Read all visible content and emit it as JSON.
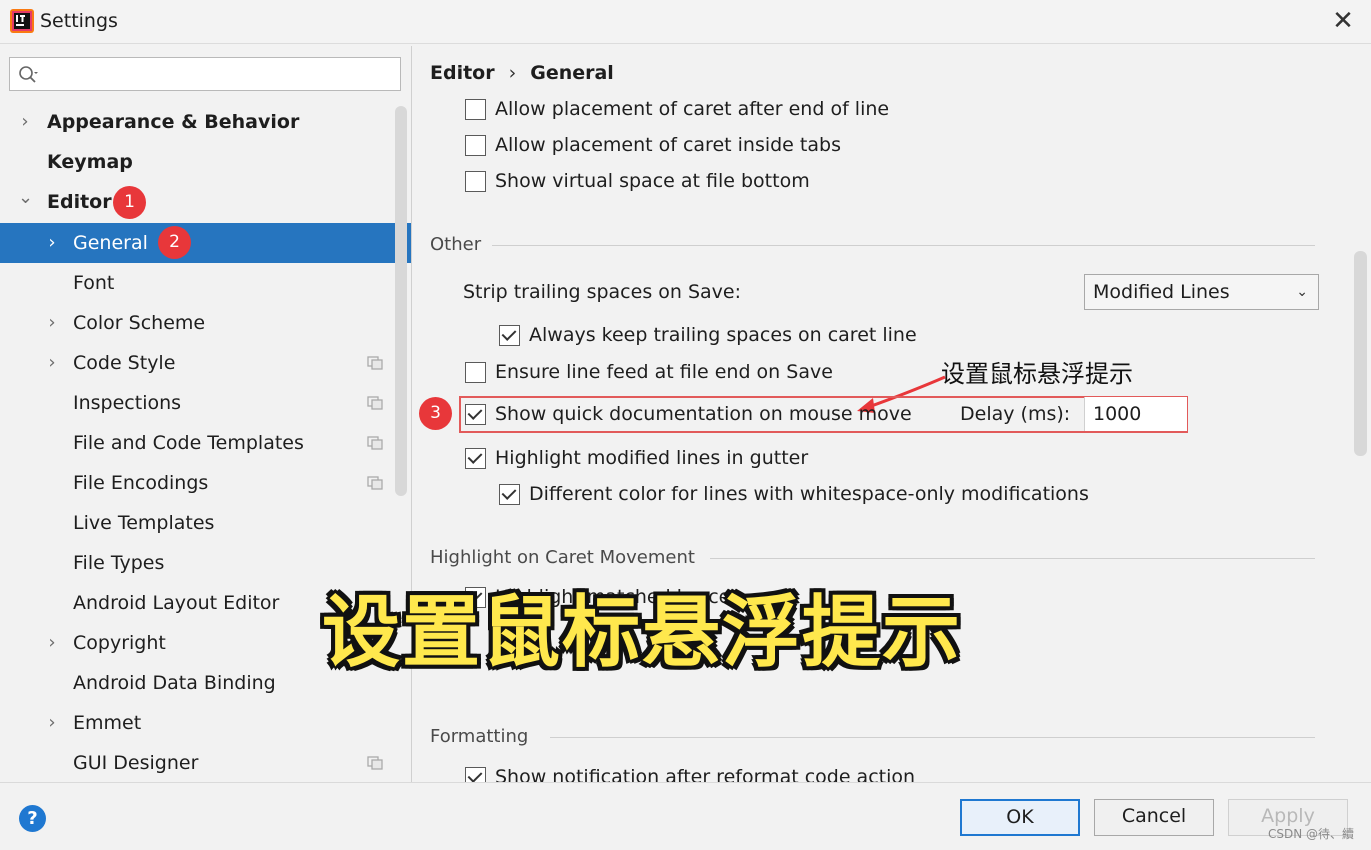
{
  "window": {
    "title": "Settings",
    "close_glyph": "✕"
  },
  "search": {
    "placeholder": ""
  },
  "sidebar": {
    "items": [
      {
        "label": "Appearance & Behavior",
        "arrow": "›",
        "badge": ""
      },
      {
        "label": "Keymap",
        "arrow": "",
        "badge": ""
      },
      {
        "label": "Editor",
        "arrow": "⌄",
        "badge": "1"
      },
      {
        "label": "General",
        "arrow": "›",
        "badge": "2"
      },
      {
        "label": "Font",
        "arrow": "",
        "badge": ""
      },
      {
        "label": "Color Scheme",
        "arrow": "›",
        "badge": ""
      },
      {
        "label": "Code Style",
        "arrow": "›",
        "badge": ""
      },
      {
        "label": "Inspections",
        "arrow": "",
        "badge": ""
      },
      {
        "label": "File and Code Templates",
        "arrow": "",
        "badge": ""
      },
      {
        "label": "File Encodings",
        "arrow": "",
        "badge": ""
      },
      {
        "label": "Live Templates",
        "arrow": "",
        "badge": ""
      },
      {
        "label": "File Types",
        "arrow": "",
        "badge": ""
      },
      {
        "label": "Android Layout Editor",
        "arrow": "",
        "badge": ""
      },
      {
        "label": "Copyright",
        "arrow": "›",
        "badge": ""
      },
      {
        "label": "Android Data Binding",
        "arrow": "",
        "badge": ""
      },
      {
        "label": "Emmet",
        "arrow": "›",
        "badge": ""
      },
      {
        "label": "GUI Designer",
        "arrow": "",
        "badge": ""
      }
    ]
  },
  "breadcrumb": {
    "parent": "Editor",
    "separator": "›",
    "current": "General"
  },
  "options": {
    "caret_after_eol": "Allow placement of caret after end of line",
    "caret_inside_tabs": "Allow placement of caret inside tabs",
    "virtual_space": "Show virtual space at file bottom",
    "strip_label": "Strip trailing spaces on Save:",
    "strip_value": "Modified Lines",
    "keep_trailing": "Always keep trailing spaces on caret line",
    "line_feed": "Ensure line feed at file end on Save",
    "quick_doc": "Show quick documentation on mouse move",
    "delay_label": "Delay (ms):",
    "delay_value": "1000",
    "highlight_modified": "Highlight modified lines in gutter",
    "whitespace_color": "Different color for lines with whitespace-only modifications",
    "highlight_braces": "Highlight matched brace",
    "show_notification": "Show notification after reformat code action"
  },
  "sections": {
    "other": "Other",
    "caret_movement": "Highlight on Caret Movement",
    "formatting": "Formatting"
  },
  "annotations": {
    "badge3": "3",
    "note": "设置鼠标悬浮提示",
    "caption": "设置鼠标悬浮提示"
  },
  "footer": {
    "help": "?",
    "ok": "OK",
    "cancel": "Cancel",
    "apply": "Apply",
    "watermark": "CSDN @待、續"
  },
  "colors": {
    "selection": "#2675bf",
    "badge": "#e8373a",
    "caption": "#ffe84d"
  }
}
